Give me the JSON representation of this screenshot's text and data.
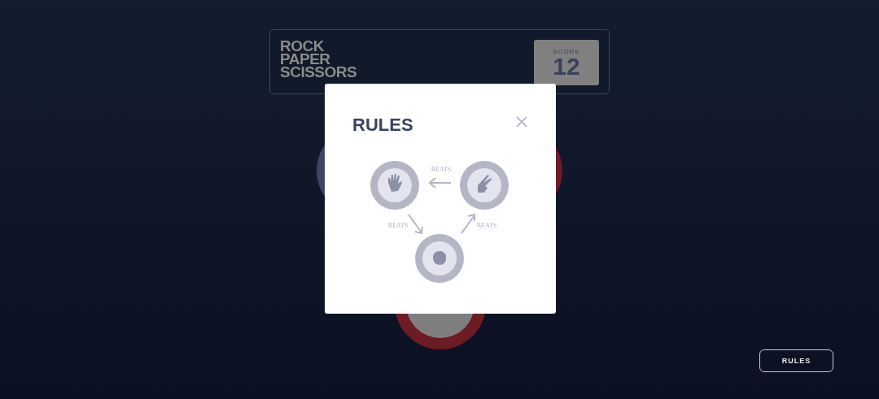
{
  "header": {
    "title_lines": [
      "ROCK",
      "PAPER",
      "SCISSORS"
    ],
    "score": {
      "label": "SCORE",
      "value": "12"
    }
  },
  "rules_modal": {
    "title": "RULES",
    "beats_labels": [
      "BEATS",
      "BEATS",
      "BEATS"
    ]
  },
  "rules_button": {
    "label": "RULES"
  }
}
